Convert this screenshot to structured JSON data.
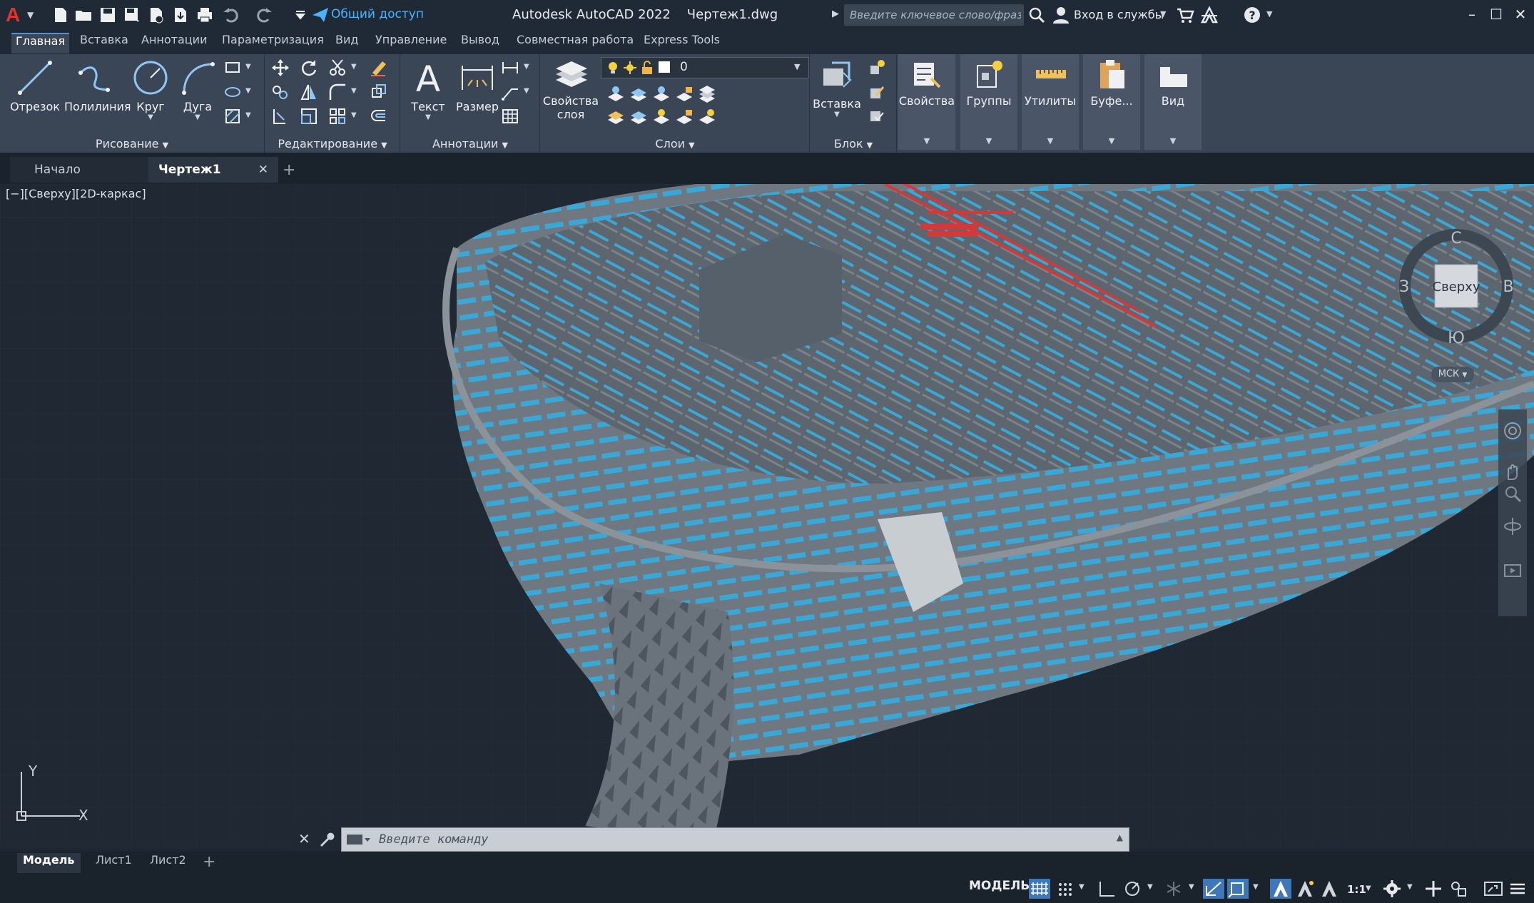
{
  "app": {
    "title": "Autodesk AutoCAD 2022",
    "filename": "Чертеж1.dwg",
    "share_label": "Общий доступ",
    "search_placeholder": "Введите ключевое слово/фразу",
    "signin_label": "Вход в службы"
  },
  "ribbon_tabs": [
    {
      "label": "Главная",
      "active": true
    },
    {
      "label": "Вставка"
    },
    {
      "label": "Аннотации"
    },
    {
      "label": "Параметризация"
    },
    {
      "label": "Вид"
    },
    {
      "label": "Управление"
    },
    {
      "label": "Вывод"
    },
    {
      "label": "Совместная работа"
    },
    {
      "label": "Express Tools"
    }
  ],
  "panels": {
    "draw": {
      "title": "Рисование",
      "tools": [
        "Отрезок",
        "Полилиния",
        "Круг",
        "Дуга"
      ]
    },
    "modify": {
      "title": "Редактирование"
    },
    "annotation": {
      "title": "Аннотации",
      "tools": [
        "Текст",
        "Размер"
      ]
    },
    "layers": {
      "title": "Слои",
      "props_label_line1": "Свойства",
      "props_label_line2": "слоя",
      "current_layer": "0"
    },
    "block": {
      "title": "Блок",
      "insert_label": "Вставка"
    },
    "big_buttons": [
      "Свойства",
      "Группы",
      "Утилиты",
      "Буфе...",
      "Вид"
    ]
  },
  "doc_tabs": [
    {
      "label": "Начало",
      "active": false
    },
    {
      "label": "Чертеж1",
      "active": true
    }
  ],
  "viewport": {
    "label": "[−][Сверху][2D-каркас]",
    "viewcube": {
      "face": "Сверху",
      "north": "С",
      "south": "Ю",
      "east": "В",
      "west": "З",
      "ucs": "МСК"
    },
    "ucs_x": "X",
    "ucs_y": "Y"
  },
  "command_line": {
    "placeholder": "Введите команду"
  },
  "layout_tabs": [
    {
      "label": "Модель",
      "active": true
    },
    {
      "label": "Лист1"
    },
    {
      "label": "Лист2"
    }
  ],
  "status": {
    "model_label": "МОДЕЛЬ",
    "scale": "1:1"
  },
  "colors": {
    "accent": "#3f78b8",
    "logo": "#e3342f",
    "hull": "#6f7780",
    "ribs": "#3aa8d6",
    "pipes": "#d23a3a"
  }
}
